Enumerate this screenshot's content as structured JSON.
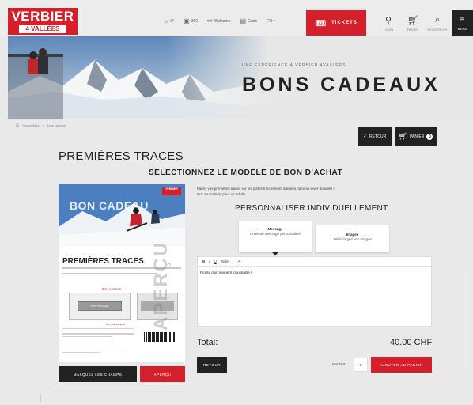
{
  "header": {
    "logo_line1": "VERBIER",
    "logo_line2": "4 VALLÉES",
    "nav": [
      {
        "icon": "sun-icon",
        "glyph": "☼",
        "label": "3°"
      },
      {
        "icon": "camera-icon",
        "glyph": "▣",
        "label": "300"
      },
      {
        "icon": "handshake-icon",
        "glyph": "⚯",
        "label": "Welcome"
      },
      {
        "icon": "map-icon",
        "glyph": "▤",
        "label": "Carte"
      },
      {
        "icon": "chevron-down-icon",
        "glyph": "",
        "label": "FR ▾"
      }
    ],
    "tickets_label": "TICKETS",
    "login_label": "LOGIN",
    "cart_label": "PANIER",
    "search_label": "RECHERCHE",
    "menu_label": "MENU"
  },
  "hero": {
    "subtitle": "UNE EXPÉRIENCE À VERBIER 4VALLÉES",
    "title": "BONS CADEAUX"
  },
  "breadcrumb": {
    "items": [
      "Stoneridges",
      "Bons cadeaux"
    ]
  },
  "actions": {
    "back_label": "RETOUR",
    "cart_label": "PANIER",
    "cart_count": "0"
  },
  "page": {
    "title": "PREMIÈRES TRACES",
    "section_title": "SÉLECTIONNEZ LE MODÈLE DE BON D'ACHAT"
  },
  "voucher": {
    "logo": "VERBIER",
    "headline": "BON CADEAU",
    "title": "PREMIÈRES TRACES",
    "tag1": "BON CADEAU",
    "box_label": "Votre message",
    "tag2": "BON DE VALEUR",
    "watermark": "APERÇU"
  },
  "preview_actions": {
    "mask_label": "MASQUEZ LES CHAMPS",
    "preview_label": "APERÇU"
  },
  "description": {
    "line1": "Faites vos premières traces sur les pistes fraîchement damées, face au lever du soleil !",
    "line2": "Prix de l'activité pour un adulte"
  },
  "personalize": {
    "title": "PERSONNALISER INDIVIDUELLEMENT",
    "tabs": [
      {
        "title": "Message",
        "desc": "Créer un message personnalisé"
      },
      {
        "title": "Images",
        "desc": "Téléchargez vos images"
      }
    ]
  },
  "editor": {
    "toolbar": [
      "B",
      "I",
      "U",
      "Taille",
      "·",
      "A·"
    ],
    "text": "Profite d'un moment inoubliable !"
  },
  "total": {
    "label": "Total:",
    "value": "40.00 CHF"
  },
  "footer_actions": {
    "back_label": "RETOUR",
    "amount_label": "Montant :",
    "quantity": "1",
    "add_label": "AJOUTER AU PANIER"
  }
}
